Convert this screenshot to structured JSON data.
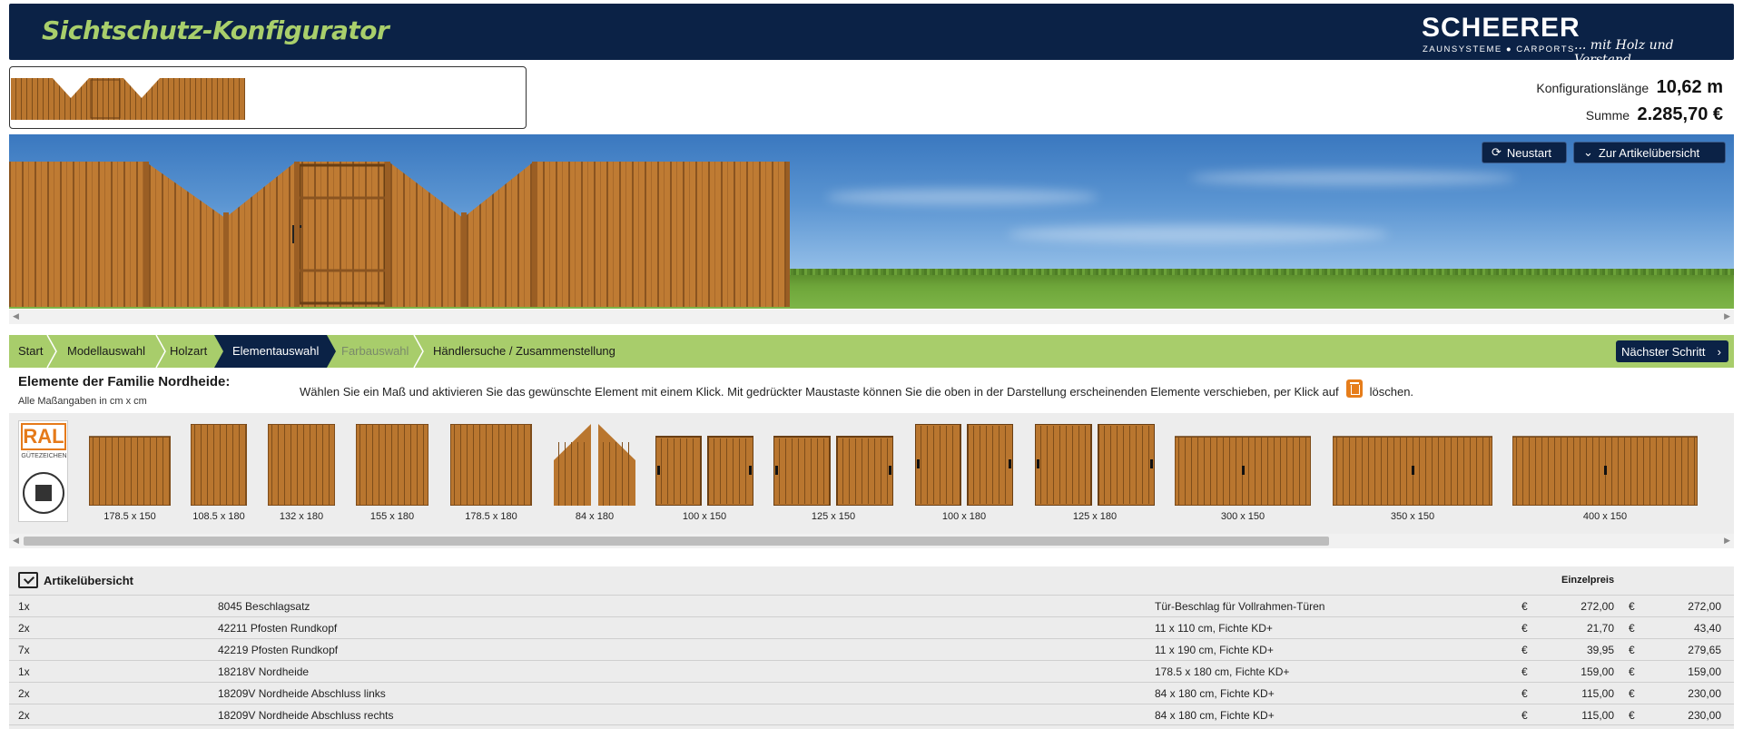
{
  "header": {
    "title": "Sichtschutz-Konfigurator",
    "logo_word": "SCHEERER",
    "logo_sub": "ZAUNSYSTEME ● CARPORTS",
    "logo_tag": "... mit Holz und Verstand."
  },
  "summary": {
    "length_label": "Konfigurationslänge",
    "length_value": "10,62 m",
    "sum_label": "Summe",
    "sum_value": "2.285,70 €"
  },
  "scene_buttons": {
    "restart": "Neustart",
    "overview": "Zur Artikelübersicht"
  },
  "steps": {
    "items": [
      "Start",
      "Modellauswahl",
      "Holzart",
      "Elementauswahl",
      "Farbauswahl",
      "Händlersuche / Zusammenstellung"
    ],
    "active": "Elementauswahl",
    "disabled": "Farbauswahl",
    "next": "Nächster Schritt"
  },
  "family": {
    "title": "Elemente der Familie Nordheide:",
    "subtitle": "Alle Maßangaben in cm x cm",
    "instructions_before": "Wählen Sie ein Maß und aktivieren Sie das gewünschte Element mit einem Klick. Mit gedrückter Maustaste können Sie die oben in der Darstellung erscheinenden Elemente verschieben, per Klick auf",
    "instructions_after": "löschen."
  },
  "ral": {
    "logo": "RAL",
    "caption": "GÜTEZEICHEN"
  },
  "elements": [
    {
      "label": "178.5 x 150"
    },
    {
      "label": "108.5 x 180"
    },
    {
      "label": "132 x 180"
    },
    {
      "label": "155 x 180"
    },
    {
      "label": "178.5 x 180"
    },
    {
      "label": "84 x 180"
    },
    {
      "label": "100 x 150"
    },
    {
      "label": "125 x 150"
    },
    {
      "label": "100 x 180"
    },
    {
      "label": "125 x 180"
    },
    {
      "label": "300 x 150"
    },
    {
      "label": "350 x 150"
    },
    {
      "label": "400 x 150"
    }
  ],
  "articles": {
    "title": "Artikelübersicht",
    "price_header": "Einzelpreis",
    "currency": "€",
    "rows": [
      {
        "qty": "1x",
        "name": "8045 Beschlagsatz",
        "desc": "Tür-Beschlag für Vollrahmen-Türen",
        "unit": "272,00",
        "total": "272,00"
      },
      {
        "qty": "2x",
        "name": "42211 Pfosten Rundkopf",
        "desc": "11 x 110 cm, Fichte KD+",
        "unit": "21,70",
        "total": "43,40"
      },
      {
        "qty": "7x",
        "name": "42219 Pfosten Rundkopf",
        "desc": "11 x 190 cm, Fichte KD+",
        "unit": "39,95",
        "total": "279,65"
      },
      {
        "qty": "1x",
        "name": "18218V Nordheide",
        "desc": "178.5 x 180 cm, Fichte KD+",
        "unit": "159,00",
        "total": "159,00"
      },
      {
        "qty": "2x",
        "name": "18209V Nordheide Abschluss links",
        "desc": "84 x 180 cm, Fichte KD+",
        "unit": "115,00",
        "total": "230,00"
      },
      {
        "qty": "2x",
        "name": "18209V Nordheide Abschluss rechts",
        "desc": "84 x 180 cm, Fichte KD+",
        "unit": "115,00",
        "total": "230,00"
      }
    ]
  },
  "colors": {
    "navy": "#0b2246",
    "accent_green": "#a8cd6b",
    "wood": "#b9762f",
    "orange": "#e67d1b"
  }
}
